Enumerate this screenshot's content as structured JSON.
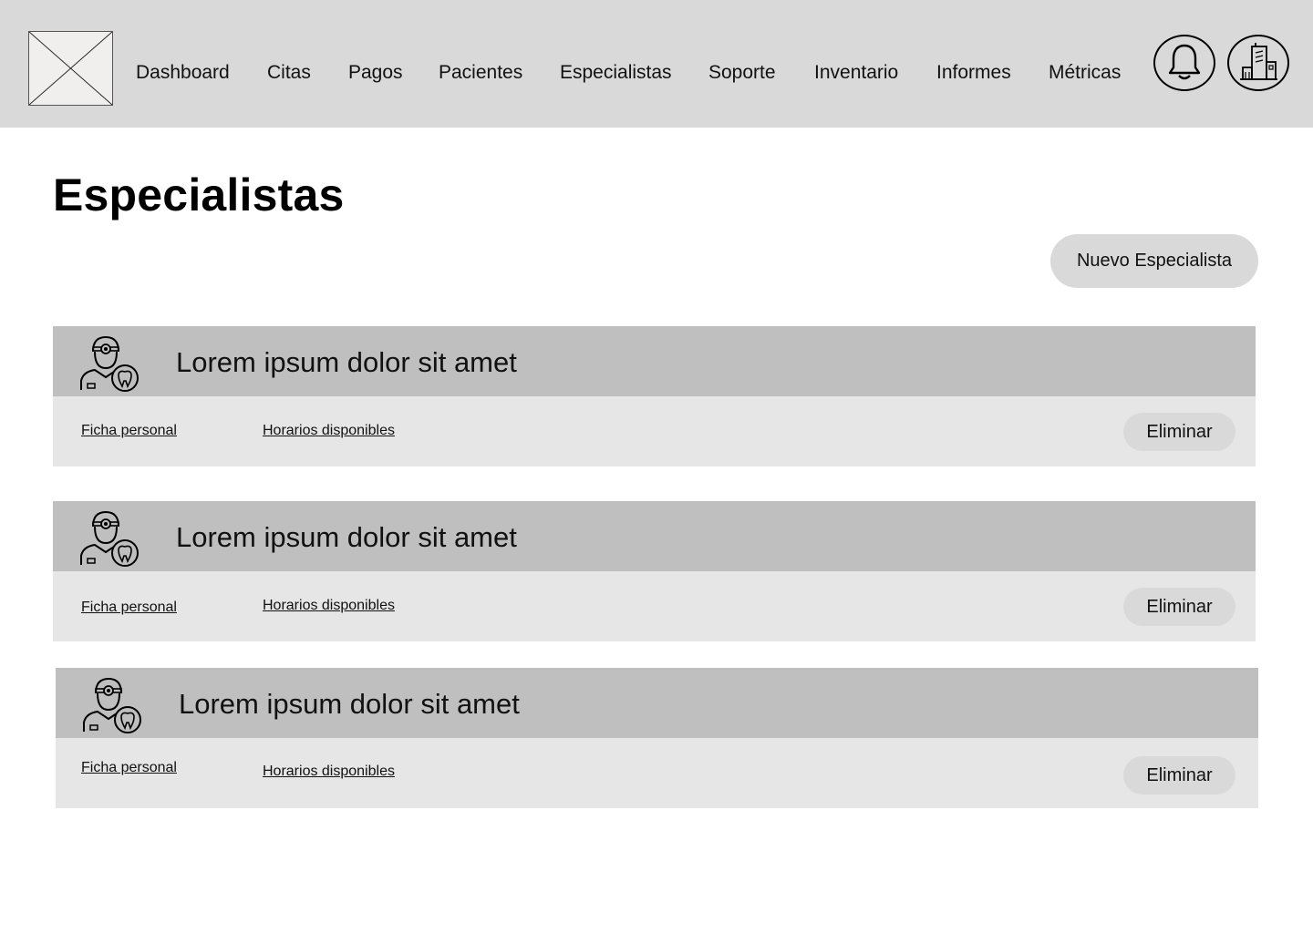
{
  "header": {
    "logo_icon": "image-placeholder-icon",
    "nav_items": [
      {
        "label": "Dashboard"
      },
      {
        "label": "Citas"
      },
      {
        "label": "Pagos"
      },
      {
        "label": "Pacientes"
      },
      {
        "label": "Especialistas"
      },
      {
        "label": "Soporte"
      },
      {
        "label": "Inventario"
      },
      {
        "label": "Informes"
      },
      {
        "label": "Métricas"
      }
    ],
    "notification_icon": "bell-icon",
    "organization_icon": "building-icon"
  },
  "page": {
    "title": "Especialistas",
    "new_button_label": "Nuevo Especialista"
  },
  "specialists": [
    {
      "name": "Lorem ipsum dolor sit amet",
      "avatar_icon": "dentist-icon",
      "link_profile": "Ficha personal",
      "link_schedule": "Horarios disponibles",
      "delete_label": "Eliminar"
    },
    {
      "name": "Lorem ipsum dolor sit amet",
      "avatar_icon": "dentist-icon",
      "link_profile": "Ficha personal",
      "link_schedule": "Horarios disponibles",
      "delete_label": "Eliminar"
    },
    {
      "name": "Lorem ipsum dolor sit amet",
      "avatar_icon": "dentist-icon",
      "link_profile": "Ficha personal",
      "link_schedule": "Horarios disponibles",
      "delete_label": "Eliminar"
    }
  ],
  "colors": {
    "header_bg": "#d9d9d9",
    "card_head_bg": "#bfbfbf",
    "card_body_bg": "#e6e6e6",
    "button_bg": "#d9d9d9"
  }
}
